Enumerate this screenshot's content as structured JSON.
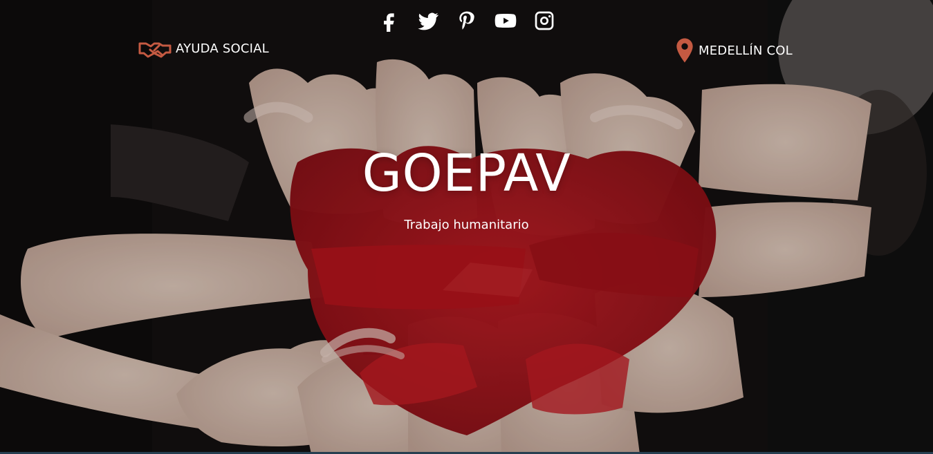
{
  "hero": {
    "title": "GOEPAV",
    "subtitle": "Trabajo humanitario"
  },
  "header": {
    "left": {
      "label": "AYUDA SOCIAL",
      "icon": "handshake-icon"
    },
    "right": {
      "label": "MEDELLÍN COL",
      "icon": "location-pin-icon"
    }
  },
  "social": [
    {
      "icon": "facebook-icon"
    },
    {
      "icon": "twitter-icon"
    },
    {
      "icon": "pinterest-icon"
    },
    {
      "icon": "youtube-icon"
    },
    {
      "icon": "instagram-icon"
    }
  ],
  "colors": {
    "accent": "#c55a42",
    "text": "#ffffff",
    "paint": "#b0141c",
    "background": "#141111",
    "bottom_bar": "#263f50"
  }
}
